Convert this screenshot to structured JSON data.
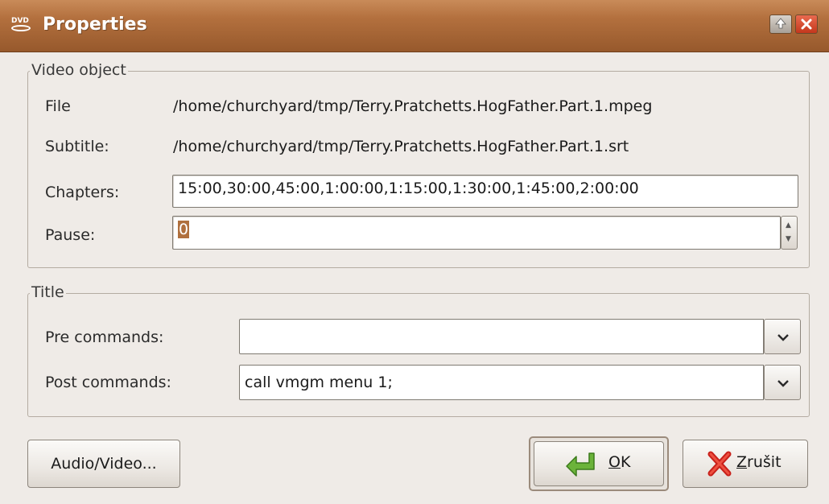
{
  "window": {
    "title": "Properties",
    "app_icon_text": "DVD"
  },
  "video_object": {
    "legend": "Video object",
    "file_label": "File",
    "file_value": "/home/churchyard/tmp/Terry.Pratchetts.HogFather.Part.1.mpeg",
    "subtitle_label": "Subtitle:",
    "subtitle_value": "/home/churchyard/tmp/Terry.Pratchetts.HogFather.Part.1.srt",
    "chapters_label": "Chapters:",
    "chapters_value": "15:00,30:00,45:00,1:00:00,1:15:00,1:30:00,1:45:00,2:00:00",
    "pause_label": "Pause:",
    "pause_value": "0"
  },
  "title_section": {
    "legend": "Title",
    "pre_label": "Pre commands:",
    "pre_value": "",
    "post_label": "Post commands:",
    "post_value": "call vmgm menu 1;"
  },
  "buttons": {
    "audio_video": "Audio/Video...",
    "ok_mnemonic": "O",
    "ok_rest": "K",
    "cancel_mnemonic": "Z",
    "cancel_rest": "rušit"
  },
  "colors": {
    "titlebar": "#b3703e",
    "selection": "#b0703e",
    "ok_icon": "#5aa02c",
    "cancel_icon": "#d62c1c"
  }
}
